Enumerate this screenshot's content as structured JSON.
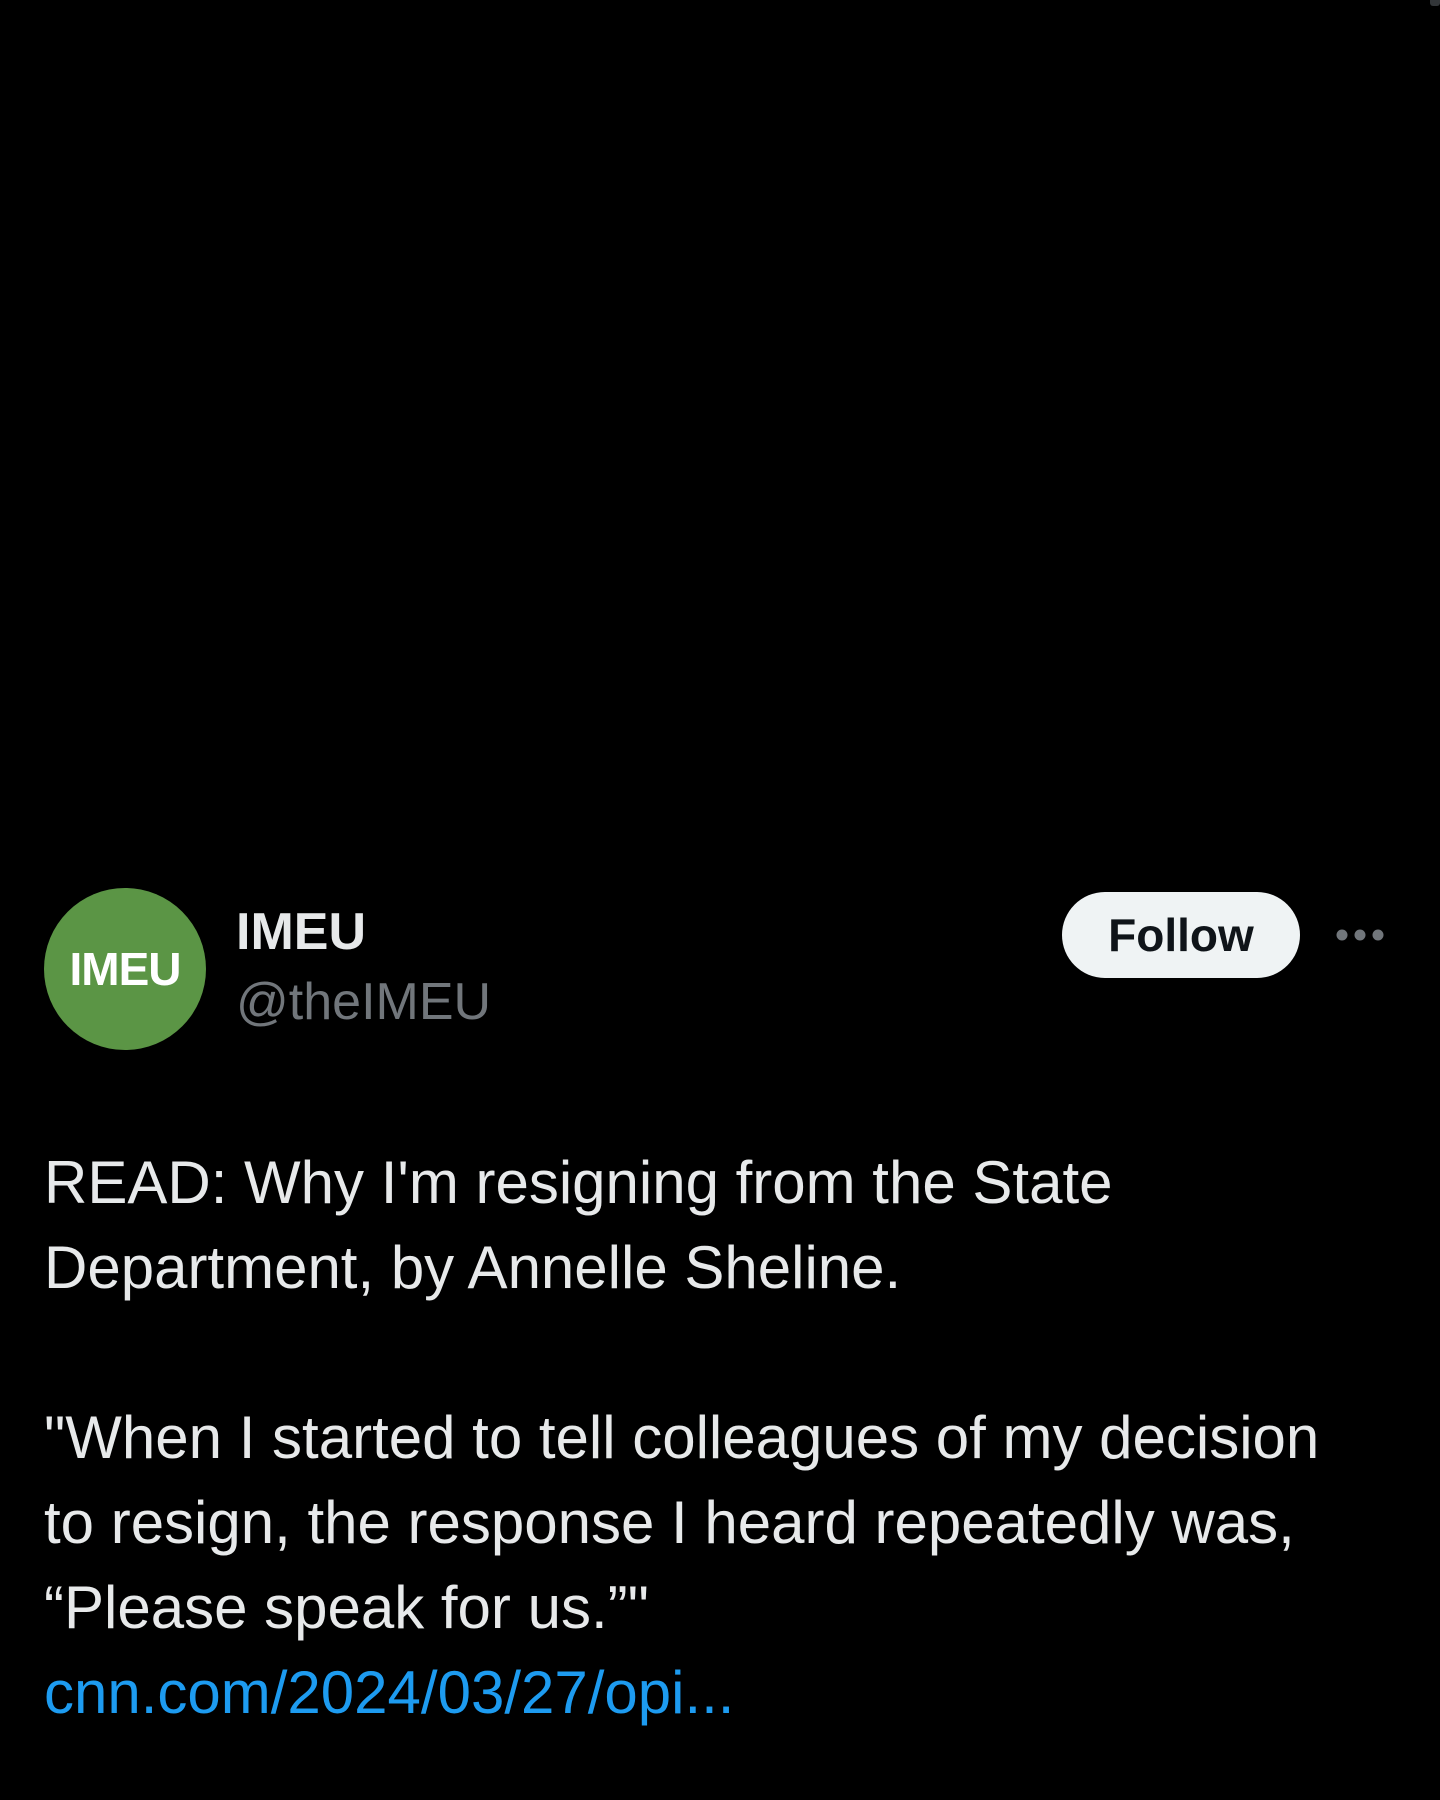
{
  "tweet": {
    "avatar": {
      "label": "IMEU",
      "color": "#5b9545"
    },
    "author": {
      "display_name": "IMEU",
      "handle": "@theIMEU"
    },
    "follow_label": "Follow",
    "more_icon": "more-horizontal-icon",
    "body": {
      "paragraph_1": "READ: Why I'm resigning from the State\nDepartment, by Annelle Sheline.",
      "paragraph_2": "\"When I started to tell colleagues of my decision\nto resign, the response I heard repeatedly was,\n“Please speak for us.”\"",
      "link": "cnn.com/2024/03/27/opi..."
    }
  },
  "colors": {
    "background": "#000000",
    "primary_text": "#e7e9ea",
    "secondary_text": "#71767b",
    "link": "#1d9bf0",
    "follow_bg": "#eff3f4"
  }
}
